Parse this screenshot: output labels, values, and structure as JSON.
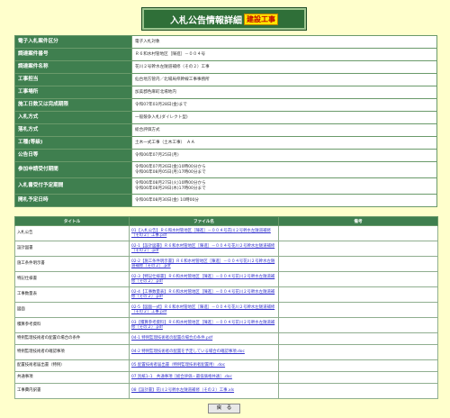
{
  "title": {
    "main": "入札公告情報詳細",
    "sub": "建設工事"
  },
  "info_rows": [
    {
      "label": "電子入札案件区分",
      "value": "電子入札対象"
    },
    {
      "label": "調達案件番号",
      "value": "Ｒ６和水村管地区［陳進］－００４号"
    },
    {
      "label": "調達案件名称",
      "value": "花川２号幹水左隧道補修（その２）工事"
    },
    {
      "label": "工事担当",
      "value": "仙台地方管内／北場局県幹線工事事務所"
    },
    {
      "label": "工事場所",
      "value": "加美郡色麻町北場地内"
    },
    {
      "label": "施工日数又は完成期限",
      "value": "令和07年03月28日(金)まで"
    },
    {
      "label": "入札方式",
      "value": "一般競争入札(ダイレクト型)"
    },
    {
      "label": "落札方式",
      "value": "総合評価方式"
    },
    {
      "label": "工種(等級)",
      "value": "土木一式工事（土木工事）　ＡＡ"
    },
    {
      "label": "公告日等",
      "value": "令和06年07月25日(月)"
    },
    {
      "label": "参加申請受付期間",
      "value": "令和06年07月26日(金)10時00分から",
      "value2": "令和06年08月05日(月)17時00分まで"
    },
    {
      "label": "入札書受付予定期間",
      "value": "令和06年08月27日(火)10時00分から",
      "value2": "令和06年08月29日(木)17時00分まで"
    },
    {
      "label": "開札予定日時",
      "value": "令和06年08月30日(金) 10時00分"
    }
  ],
  "docs_headers": {
    "title": "タイトル",
    "file": "ファイル名",
    "note": "備考"
  },
  "docs": [
    {
      "title": "入札公告",
      "file": "01【入札公告】Ｒ６和水村管地区［陳進］－００４号花川２号幹水左隧道補修（その２）工事.pdf",
      "tall": true
    },
    {
      "title": "設計図書",
      "file": "02-1【設計図書】Ｒ６和水村管地区［陳進］－００４号花川２号幹水左隧道補修（その２）.pdf",
      "tall": true
    },
    {
      "title": "施工条件明示書",
      "file": "02-2【施工条件明示書】Ｒ６和水村管地区［陳進］－００４号花川２号幹水左隧道補修（その２）.pdf",
      "tall": true
    },
    {
      "title": "特記仕様書",
      "file": "02-3【特記仕様書】Ｒ６和水村管地区［陳進］－００４号花川２号幹水左隧道補修（その２）.pdf",
      "tall": true
    },
    {
      "title": "工事数量表",
      "file": "02-4【工事数量表】Ｒ６和水村管地区［陳進］－００４号花川２号幹水左隧道補修（その２）.pdf",
      "tall": true
    },
    {
      "title": "図面",
      "file": "02-5【図面一式】Ｒ６和水村管地区［陳進］－００４号花川２号幹水左隧道補修（その２）工事.pdf",
      "tall": true
    },
    {
      "title": "積算参考資料",
      "file": "03【積算参考資料】Ｒ６和水村管地区［陳進］－００４号花川２号幹水左隧道補修（その２）.pdf",
      "tall": true
    },
    {
      "title": "特例監理技術者の配置の場合の条件",
      "file": "04-1 特例監理技術者の配置の場合の条件.pdf",
      "tall": false
    },
    {
      "title": "特例監理技術者の確認事項",
      "file": "04-2 特例監理技術者の配置を予定している場合の確認事項.doc",
      "tall": true
    },
    {
      "title": "配置技術者届出書（特例）",
      "file": "05 配置技術者届出書（特例監理技術者配置用）.doc",
      "tall": false
    },
    {
      "title": "共通事項",
      "file": "07 別紙1ｰ1　共通事項［総合評価・最低価格共通］.doc",
      "tall": false
    },
    {
      "title": "工事費内訳書",
      "file": "08【設計書】花川２号幹水左隧道補修（その２）工事.xls",
      "tall": true
    }
  ],
  "back_button": "戻　る"
}
